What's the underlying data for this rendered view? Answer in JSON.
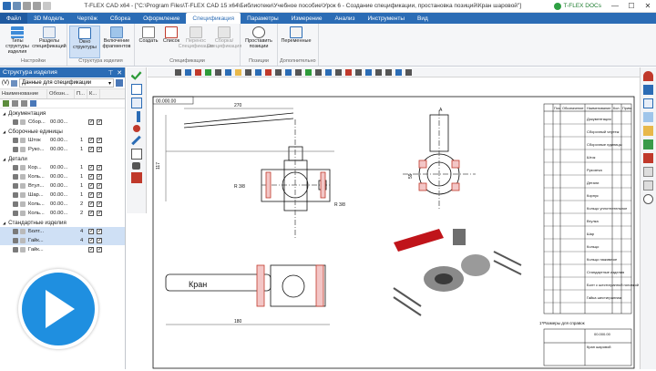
{
  "titlebar": {
    "title": "T-FLEX CAD x64 - [\"C:\\Program Files\\T-FLEX CAD 15 x64\\Библиотеки\\Учебное пособие\\Урок 6 - Создание спецификации, простановка позиций\\Кран шаровой\"]",
    "docs_label": "T-FLEX DOCs",
    "minimize": "—",
    "maximize": "☐",
    "close": "✕"
  },
  "menu": {
    "tabs": [
      "Файл",
      "3D Модель",
      "Чертёж",
      "Сборка",
      "Оформление",
      "Спецификация",
      "Параметры",
      "Измерение",
      "Анализ",
      "Инструменты",
      "Вид"
    ],
    "active_index": 5
  },
  "ribbon": {
    "groups": [
      {
        "label": "Настройки",
        "buttons": [
          "Типы структуры изделия",
          "Разделы спецификаций"
        ]
      },
      {
        "label": "Структура изделия",
        "buttons": [
          "Окно структуры",
          "Включение фрагментов"
        ]
      },
      {
        "label": "Спецификации",
        "buttons": [
          "Создать",
          "Список",
          "Перенос Спецификации",
          "Сборка/Спецификация"
        ]
      },
      {
        "label": "Позиции",
        "buttons": [
          "Проставить позиции"
        ]
      },
      {
        "label": "Дополнительно",
        "buttons": [
          "Переменные"
        ]
      }
    ]
  },
  "left_panel": {
    "title": "Структура изделия",
    "pin": "⊤",
    "close": "✕",
    "filter_prefix": "(V)",
    "filter_value": "Данные для спецификации",
    "columns": [
      "Наименование",
      "Обозн...",
      "П...",
      "К..."
    ],
    "sections": [
      {
        "name": "Документация",
        "rows": [
          {
            "name": "Сбор...",
            "code": "00.00...",
            "qty": ""
          }
        ]
      },
      {
        "name": "Сборочные единицы",
        "rows": [
          {
            "name": "Шток",
            "code": "00.00...",
            "qty": "1"
          },
          {
            "name": "Руко...",
            "code": "00.00...",
            "qty": "1"
          }
        ]
      },
      {
        "name": "Детали",
        "rows": [
          {
            "name": "Кор...",
            "code": "00.00...",
            "qty": "1"
          },
          {
            "name": "Коль...",
            "code": "00.00...",
            "qty": "1"
          },
          {
            "name": "Втул...",
            "code": "00.00...",
            "qty": "1"
          },
          {
            "name": "Шар...",
            "code": "00.00...",
            "qty": "1"
          },
          {
            "name": "Коль...",
            "code": "00.00...",
            "qty": "2"
          },
          {
            "name": "Коль...",
            "code": "00.00...",
            "qty": "2"
          }
        ]
      },
      {
        "name": "Стандартные изделия",
        "rows": [
          {
            "name": "Болт...",
            "code": "",
            "qty": "4"
          },
          {
            "name": "Гайк...",
            "code": "",
            "qty": "4"
          },
          {
            "name": "Гайк...",
            "code": "",
            "qty": ""
          }
        ]
      }
    ]
  },
  "drawing": {
    "stamp_code": "00.000.00",
    "spec_header": [
      "Поз.",
      "Обозначение",
      "Наименование",
      "Кол.",
      "Прим."
    ],
    "spec_rows": [
      "Документация",
      "Сборочный чертеж",
      "Сборочные единицы",
      "Шток",
      "Рукоятка",
      "Детали",
      "Корпус",
      "Кольцо уплотнительное",
      "Втулка",
      "Шар",
      "Кольцо",
      "Кольцо нажимное",
      "Стандартные изделия",
      "Болт с шестигранной головкой",
      "Гайка шестигранная"
    ],
    "note": "1*Размеры для справок",
    "title_block_name": "Кран шаровой",
    "handle_text": "Кран",
    "dims": {
      "length": "270",
      "height": "117",
      "width": "180",
      "thread": "R 3/8",
      "dia": "59",
      "sec": "А"
    }
  },
  "play_button": "play-icon"
}
